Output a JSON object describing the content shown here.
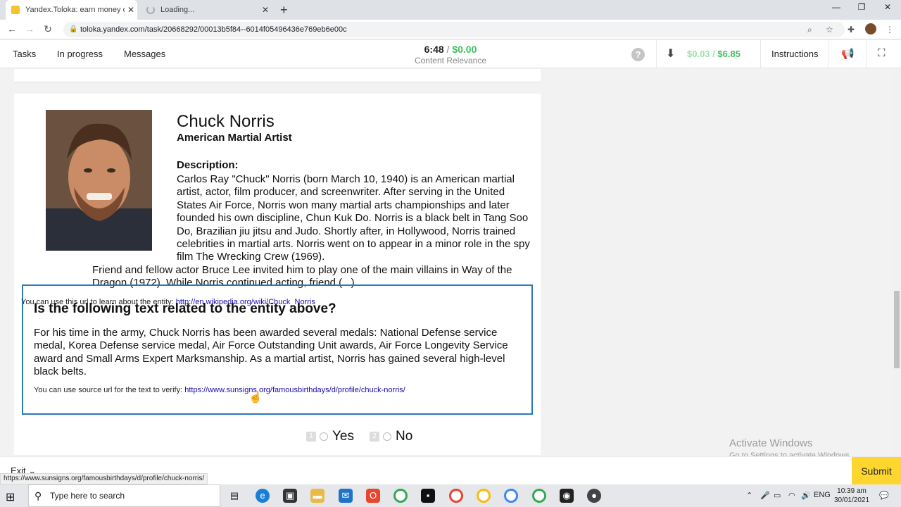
{
  "browser": {
    "tabs": [
      {
        "title": "Yandex.Toloka: earn money onlin",
        "active": true
      },
      {
        "title": "Loading...",
        "active": false
      }
    ],
    "url": "toloka.yandex.com/task/20668292/00013b5f84--6014f05496436e769eb6e00c",
    "status_url": "https://www.sunsigns.org/famousbirthdays/d/profile/chuck-norris/"
  },
  "appbar": {
    "nav": [
      "Tasks",
      "In progress",
      "Messages"
    ],
    "timer": "6:48",
    "separator": "/",
    "task_reward": "$0.00",
    "project_name": "Content Relevance",
    "help_label": "?",
    "earn_pending": "$0.03",
    "earn_sep": "/",
    "earn_total": "$6.85",
    "instructions": "Instructions"
  },
  "entity": {
    "name": "Chuck Norris",
    "subtitle": "American Martial Artist",
    "description_label": "Description:",
    "description": "Carlos Ray \"Chuck\" Norris (born March 10, 1940) is an American martial artist, actor, film producer, and screenwriter. After serving in the United States Air Force, Norris won many martial arts championships and later founded his own discipline, Chun Kuk Do. Norris is a black belt in Tang Soo Do, Brazilian jiu jitsu and Judo. Shortly after, in Hollywood, Norris trained celebrities in martial arts. Norris went on to appear in a minor role in the spy film The Wrecking Crew (1969).",
    "description_cont": "Friend and fellow actor Bruce Lee invited him to play one of the main villains in Way of the Dragon (1972). While Norris continued acting, friend (...)",
    "wiki_note": "You can use this url to learn about the entity:",
    "wiki_url": "http://en.wikipedia.org/wiki/Chuck_Norris"
  },
  "question": {
    "title": "Is the following text related to the entity above?",
    "text": "For his time in the army, Chuck Norris has been awarded several medals: National Defense service medal, Korea Defense service medal, Air Force Outstanding Unit awards, Air Force Longevity Service award and Small Arms Expert Marksmanship. As a martial artist, Norris has gained several high-level black belts.",
    "source_note": "You can use source url for the text to verify:",
    "source_url": "https://www.sunsigns.org/famousbirthdays/d/profile/chuck-norris/",
    "answers": [
      {
        "key": "1",
        "label": "Yes"
      },
      {
        "key": "2",
        "label": "No"
      }
    ]
  },
  "bottom": {
    "exit": "Exit",
    "submit": "Submit"
  },
  "watermark": {
    "line1": "Activate Windows",
    "line2": "Go to Settings to activate Windows."
  },
  "taskbar": {
    "search_placeholder": "Type here to search",
    "lang": "ENG",
    "time": "10:39 am",
    "date": "30/01/2021"
  }
}
